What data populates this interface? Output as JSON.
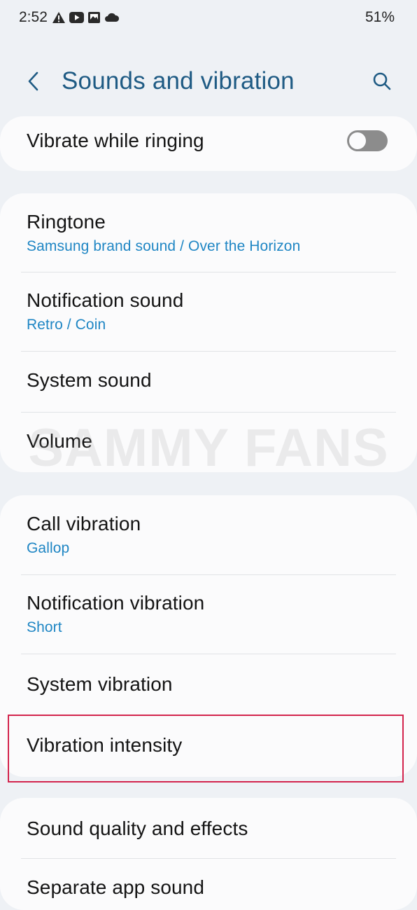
{
  "status_bar": {
    "time": "2:52",
    "battery": "51%",
    "icons": [
      "warning-icon",
      "youtube-icon",
      "gallery-icon",
      "cloud-icon"
    ]
  },
  "header": {
    "title": "Sounds and vibration",
    "back_icon": "chevron-left-icon",
    "search_icon": "search-icon"
  },
  "vibrate_while_ringing": {
    "label": "Vibrate while ringing",
    "enabled": false
  },
  "sounds": [
    {
      "title": "Ringtone",
      "subtitle": "Samsung brand sound / Over the Horizon"
    },
    {
      "title": "Notification sound",
      "subtitle": "Retro / Coin"
    },
    {
      "title": "System sound"
    },
    {
      "title": "Volume"
    }
  ],
  "vibrations": [
    {
      "title": "Call vibration",
      "subtitle": "Gallop"
    },
    {
      "title": "Notification vibration",
      "subtitle": "Short"
    },
    {
      "title": "System vibration"
    },
    {
      "title": "Vibration intensity"
    }
  ],
  "more": [
    {
      "title": "Sound quality and effects"
    },
    {
      "title": "Separate app sound"
    }
  ],
  "watermark": "SAMMY FANS",
  "colors": {
    "title_blue": "#1f5b84",
    "subtitle_blue": "#1f86c4",
    "highlight_red": "#d3244d",
    "background": "#eef1f5",
    "card": "#fbfbfc"
  }
}
